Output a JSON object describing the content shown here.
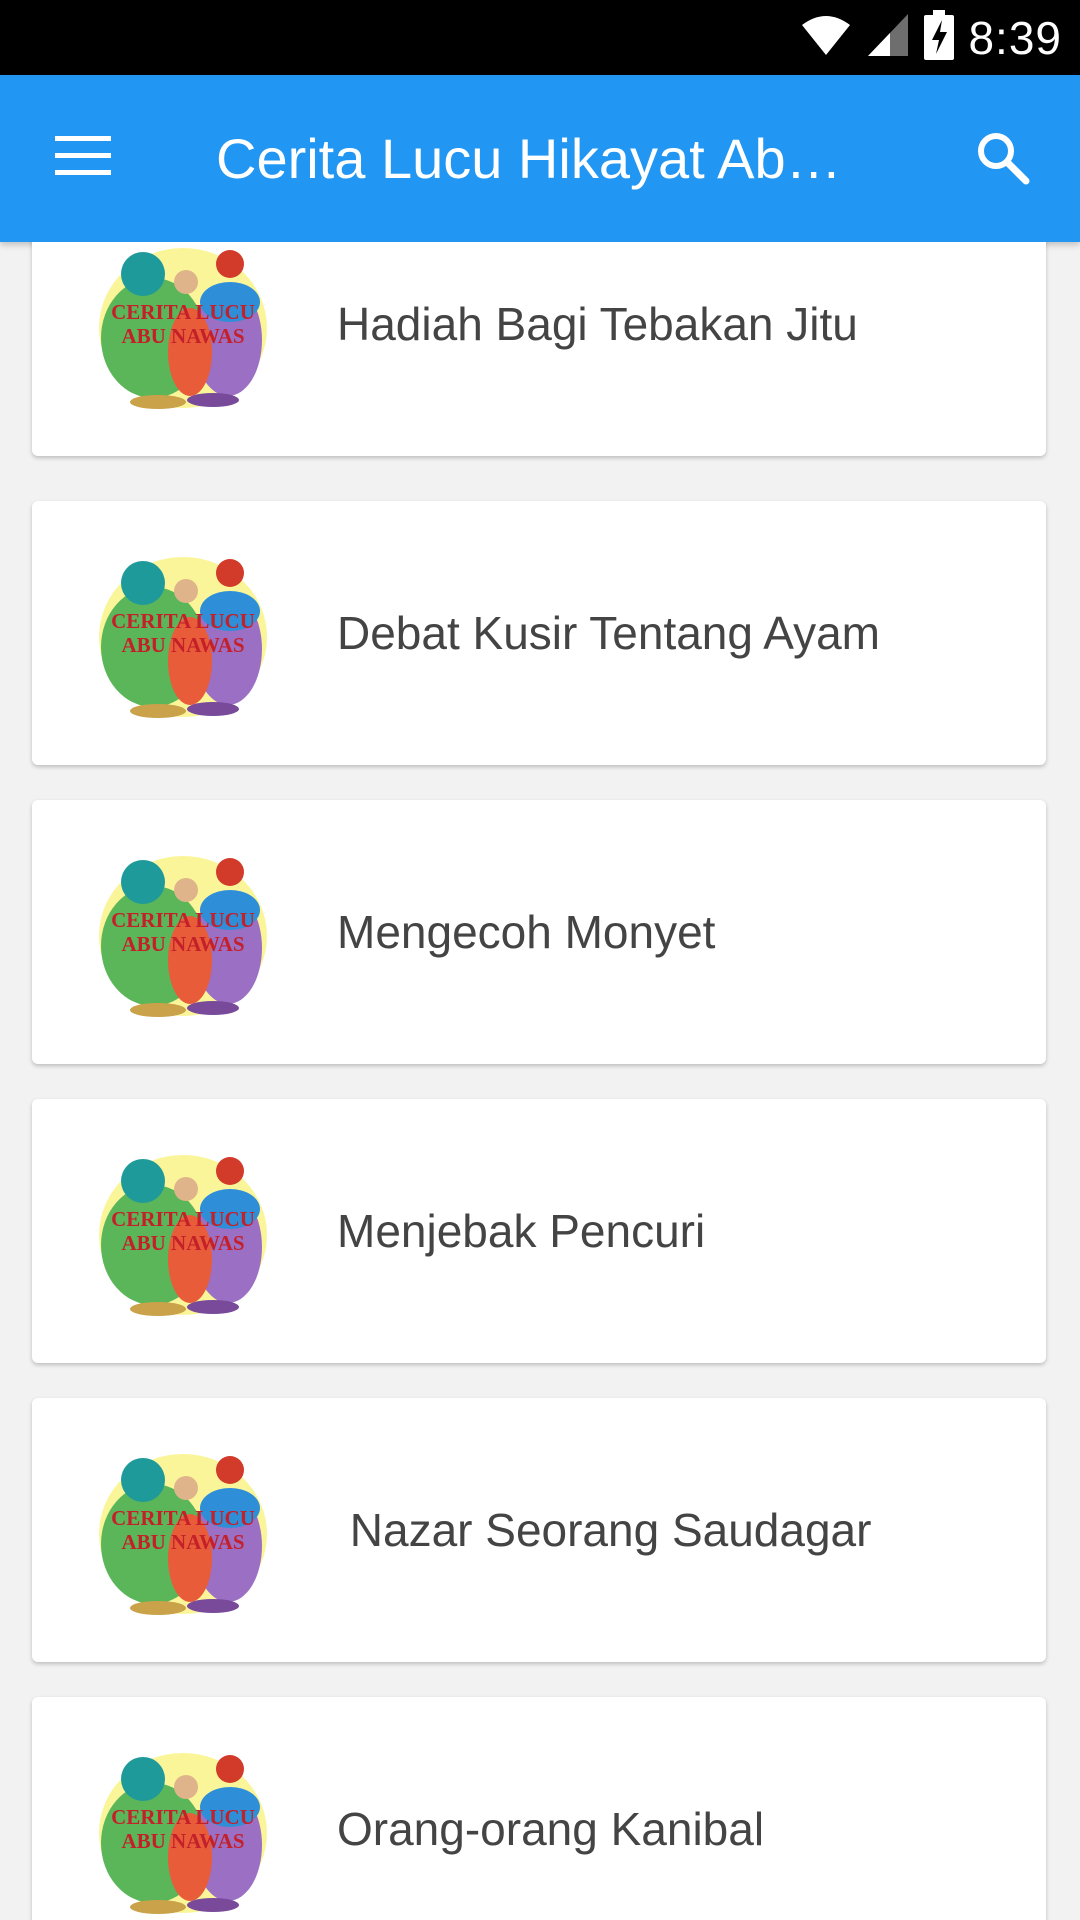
{
  "status_bar": {
    "time": "8:39",
    "icons": [
      "wifi-icon",
      "signal-icon",
      "battery-charging-icon"
    ]
  },
  "app_bar": {
    "title": "Cerita Lucu Hikayat Ab…",
    "menu_icon": "hamburger-menu-icon",
    "search_icon": "search-icon",
    "color": "#2196f3"
  },
  "stories": [
    {
      "title": "Hadiah Bagi Tebakan Jitu",
      "thumb_label_top": "CERITA LUCU",
      "thumb_label_bottom": "ABU NAWAS"
    },
    {
      "title": "Debat Kusir Tentang Ayam",
      "thumb_label_top": "CERITA LUCU",
      "thumb_label_bottom": "ABU NAWAS"
    },
    {
      "title": "Mengecoh Monyet",
      "thumb_label_top": "CERITA LUCU",
      "thumb_label_bottom": "ABU NAWAS"
    },
    {
      "title": "Menjebak Pencuri",
      "thumb_label_top": "CERITA LUCU",
      "thumb_label_bottom": "ABU NAWAS"
    },
    {
      "title": " Nazar Seorang Saudagar",
      "thumb_label_top": "CERITA LUCU",
      "thumb_label_bottom": "ABU NAWAS"
    },
    {
      "title": "Orang-orang Kanibal",
      "thumb_label_top": "CERITA LUCU",
      "thumb_label_bottom": "ABU NAWAS"
    }
  ]
}
